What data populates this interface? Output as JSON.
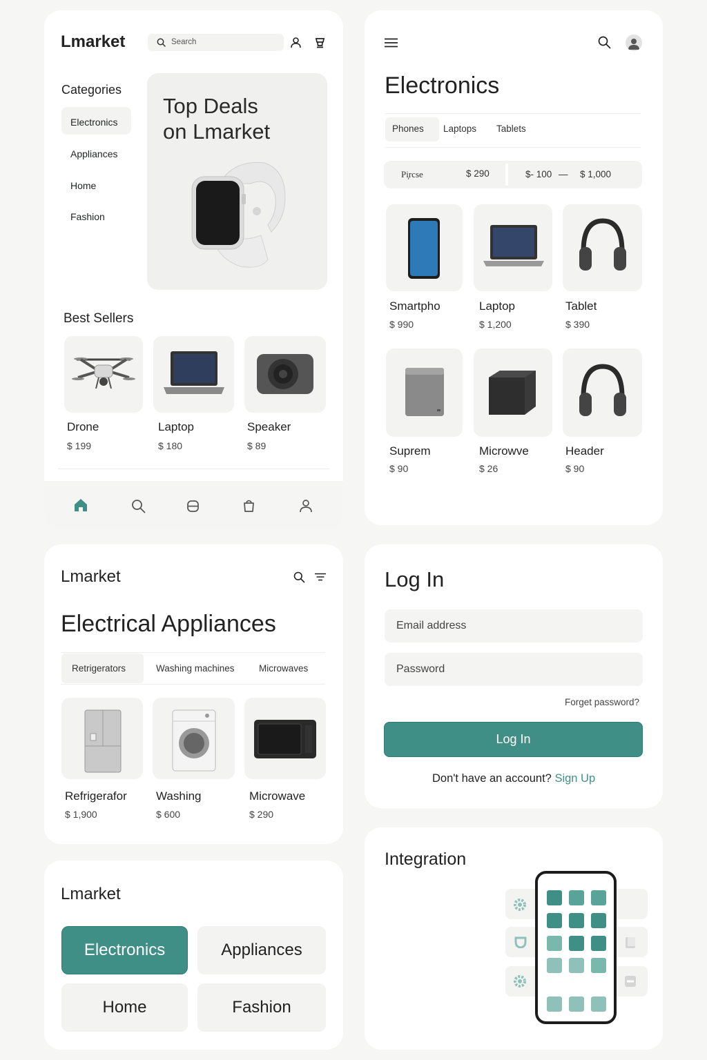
{
  "colors": {
    "accent": "#3f8f86",
    "page_bg": "#f6f6f4",
    "card_bg": "#ffffff",
    "muted_bg": "#f3f3f2"
  },
  "home": {
    "logo": "Lmarket",
    "search_placeholder": "Search",
    "categories_title": "Categories",
    "categories": [
      "Electronics",
      "Appliances",
      "Home",
      "Fashion"
    ],
    "hero_title_line1": "Top Deals",
    "hero_title_line2": "on Lmarket",
    "best_sellers_title": "Best Sellers",
    "best_sellers": [
      {
        "name": "Drone",
        "price": "$ 199"
      },
      {
        "name": "Laptop",
        "price": "$ 180"
      },
      {
        "name": "Speaker",
        "price": "$ 89"
      }
    ],
    "bottom_nav": [
      "home-icon",
      "search-icon",
      "message-icon",
      "bag-icon",
      "user-icon"
    ]
  },
  "electronics": {
    "title": "Electronics",
    "tabs": [
      "Phones",
      "Laptops",
      "Tablets"
    ],
    "filter_label": "Pi᷊rcse",
    "filter_price": "$ 290",
    "range_min": "$- 100",
    "range_dash": "—",
    "range_max": "$ 1,000",
    "products": [
      {
        "name": "Smartpho",
        "price": "$ 990"
      },
      {
        "name": "Laptop",
        "price": "$ 1,200"
      },
      {
        "name": "Tablet",
        "price": "$ 390"
      },
      {
        "name": "Suprem",
        "price": "$ 90"
      },
      {
        "name": "Microwve",
        "price": "$ 26"
      },
      {
        "name": "Header",
        "price": "$ 90"
      }
    ]
  },
  "appliances": {
    "logo": "Lmarket",
    "title": "Electrical Appliances",
    "tabs": [
      "Retrigerators",
      "Washing machines",
      "Microwaves"
    ],
    "products": [
      {
        "name": "Refrigerafor",
        "price": "$ 1,900"
      },
      {
        "name": "Washing",
        "price": "$ 600"
      },
      {
        "name": "Microwave",
        "price": "$ 290"
      }
    ]
  },
  "login": {
    "title": "Log In",
    "email_placeholder": "Email address",
    "password_placeholder": "Password",
    "forgot": "Forget password?",
    "button": "Log In",
    "no_account": "Don't have an account?",
    "signup": "Sign Up"
  },
  "category_picker": {
    "logo": "Lmarket",
    "options": [
      "Electronics",
      "Appliances",
      "Home",
      "Fashion"
    ],
    "selected": "Electronics"
  },
  "integration": {
    "title": "Integration"
  }
}
